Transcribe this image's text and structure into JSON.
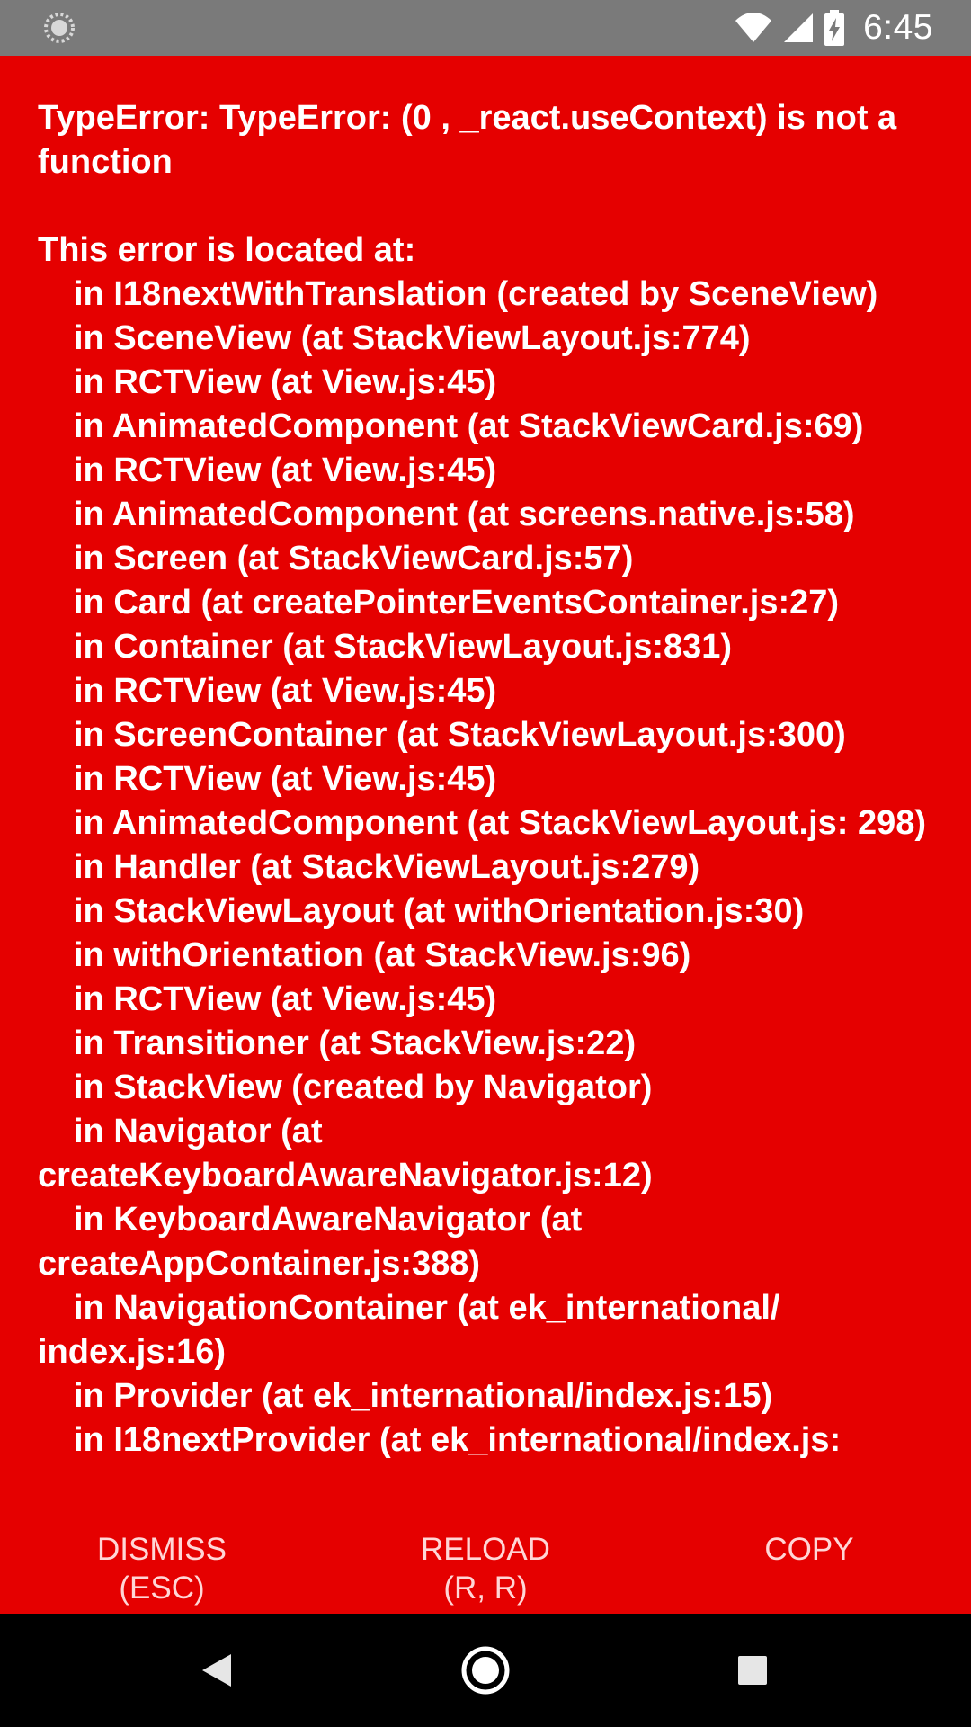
{
  "status_bar": {
    "time": "6:45",
    "left_icon": "loading-spinner-icon",
    "icons": [
      "wifi-icon",
      "cell-signal-icon",
      "battery-charging-icon"
    ]
  },
  "colors": {
    "background": "#e50000",
    "status_bar": "#7a7a7a",
    "text": "#ffffff",
    "button_text": "#ffd6d6",
    "nav_bar": "#000000"
  },
  "error": {
    "title": "TypeError: TypeError: (0 , _react.useContext) is not a function",
    "stack_header": "This error is located at:",
    "stack": [
      "in I18nextWithTranslation (created by SceneView)",
      "in SceneView (at StackViewLayout.js:774)",
      "in RCTView (at View.js:45)",
      "in AnimatedComponent (at StackViewCard.js:69)",
      "in RCTView (at View.js:45)",
      "in AnimatedComponent (at screens.native.js:58)",
      "in Screen (at StackViewCard.js:57)",
      "in Card (at createPointerEventsContainer.js:27)",
      "in Container (at StackViewLayout.js:831)",
      "in RCTView (at View.js:45)",
      "in ScreenContainer (at StackViewLayout.js:300)",
      "in RCTView (at View.js:45)",
      "in AnimatedComponent (at StackViewLayout.js: 298)",
      "in Handler (at StackViewLayout.js:279)",
      "in StackViewLayout (at withOrientation.js:30)",
      "in withOrientation (at StackView.js:96)",
      "in RCTView (at View.js:45)",
      "in Transitioner (at StackView.js:22)",
      "in StackView (created by Navigator)",
      "in Navigator (at createKeyboardAwareNavigator.js:12)",
      "in KeyboardAwareNavigator (at createAppContainer.js:388)",
      "in NavigationContainer (at ek_international/ index.js:16)",
      "in Provider (at ek_international/index.js:15)",
      "in I18nextProvider (at ek_international/index.js:"
    ]
  },
  "buttons": {
    "dismiss": {
      "line1": "DISMISS",
      "line2": "(ESC)"
    },
    "reload": {
      "line1": "RELOAD",
      "line2": "(R, R)"
    },
    "copy": {
      "line1": "COPY",
      "line2": ""
    }
  },
  "nav": {
    "back": "back-triangle-icon",
    "home": "home-circle-icon",
    "recents": "recents-square-icon"
  }
}
